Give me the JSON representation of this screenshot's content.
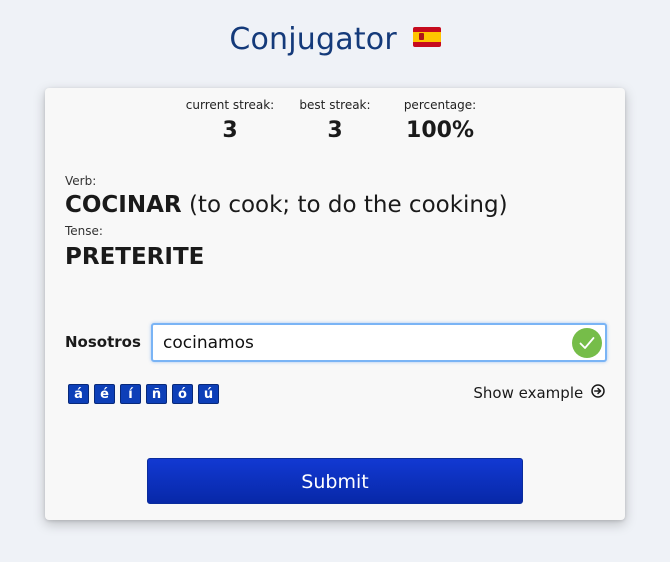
{
  "app": {
    "title": "Conjugator",
    "flag_icon": "spain-flag-icon"
  },
  "stats": {
    "current_streak_label": "current streak:",
    "current_streak_value": "3",
    "best_streak_label": "best streak:",
    "best_streak_value": "3",
    "percentage_label": "percentage:",
    "percentage_value": "100%"
  },
  "question": {
    "verb_label": "Verb:",
    "verb": "COCINAR",
    "verb_translation": "(to cook; to do the cooking)",
    "tense_label": "Tense:",
    "tense": "PRETERITE",
    "pronoun": "Nosotros"
  },
  "answer": {
    "value": "cocinamos",
    "status": "correct",
    "status_icon": "check-circle-icon",
    "status_color": "#76bd49"
  },
  "accents": [
    "á",
    "é",
    "í",
    "ñ",
    "ó",
    "ú"
  ],
  "show_example": {
    "label": "Show example",
    "icon": "circle-arrow-right-icon"
  },
  "submit": {
    "label": "Submit",
    "color": "#0d34c4"
  }
}
